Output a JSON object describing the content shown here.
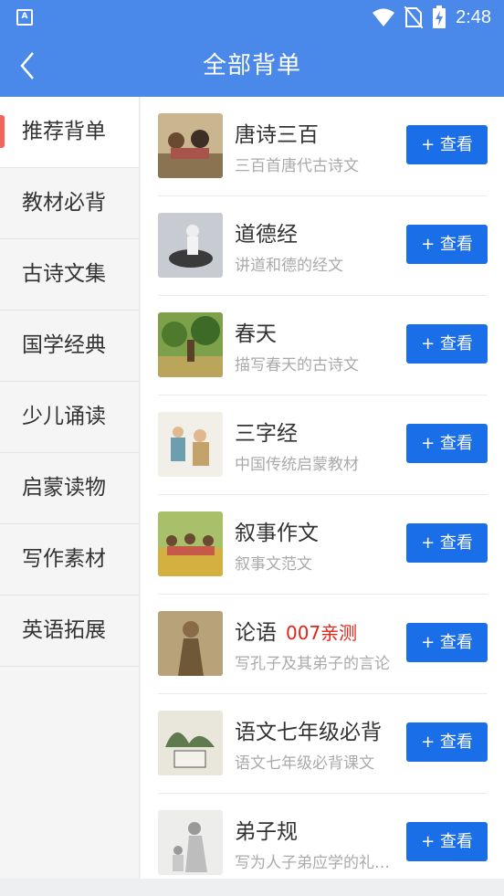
{
  "status": {
    "time": "2:48",
    "left_icon": "A"
  },
  "navbar": {
    "title": "全部背单"
  },
  "sidebar": {
    "items": [
      {
        "label": "推荐背单",
        "active": true
      },
      {
        "label": "教材必背"
      },
      {
        "label": "古诗文集"
      },
      {
        "label": "国学经典"
      },
      {
        "label": "少儿诵读"
      },
      {
        "label": "启蒙读物"
      },
      {
        "label": "写作素材"
      },
      {
        "label": "英语拓展"
      }
    ]
  },
  "list": {
    "button_label": "+ 查看",
    "items": [
      {
        "title": "唐诗三百",
        "subtitle": "三百首唐代古诗文",
        "tag": ""
      },
      {
        "title": "道德经",
        "subtitle": "讲道和德的经文",
        "tag": ""
      },
      {
        "title": "春天",
        "subtitle": "描写春天的古诗文",
        "tag": ""
      },
      {
        "title": "三字经",
        "subtitle": "中国传统启蒙教材",
        "tag": ""
      },
      {
        "title": "叙事作文",
        "subtitle": "叙事文范文",
        "tag": ""
      },
      {
        "title": "论语",
        "subtitle": "写孔子及其弟子的言论",
        "tag": "007亲测"
      },
      {
        "title": "语文七年级必背",
        "subtitle": "语文七年级必背课文",
        "tag": ""
      },
      {
        "title": "弟子规",
        "subtitle": "写为人子弟应学的礼…",
        "tag": ""
      }
    ]
  },
  "colors": {
    "header": "#4a88ea",
    "button": "#1a6ee8",
    "active_marker": "#f0665a",
    "tag": "#e0251b"
  }
}
